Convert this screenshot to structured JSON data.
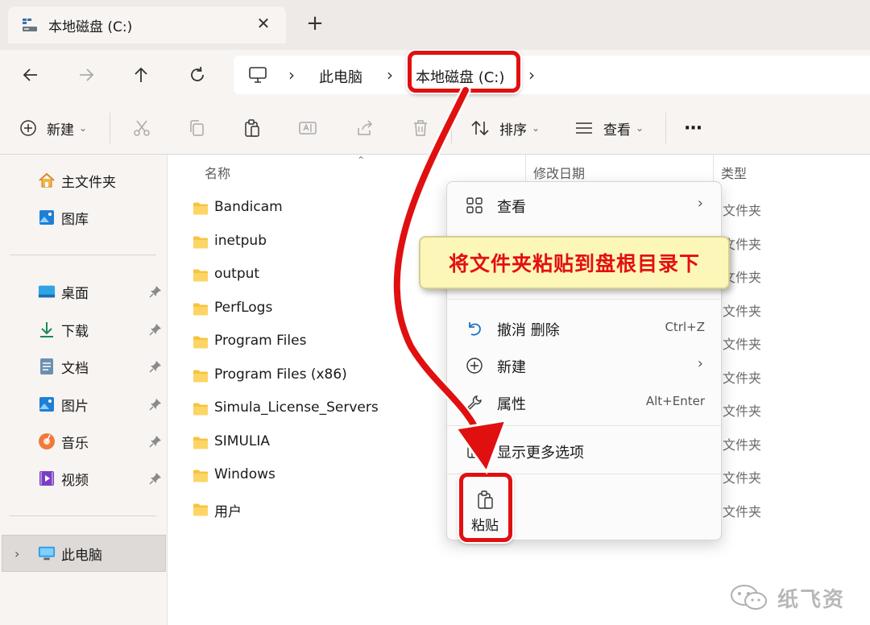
{
  "window": {
    "tab_title": "本地磁盘 (C:)",
    "tab_close": "✕",
    "new_tab": "+"
  },
  "address": {
    "crumbs": [
      "此电脑",
      "本地磁盘 (C:)"
    ],
    "separator": "›"
  },
  "commandbar": {
    "new_label": "新建",
    "sort_label": "排序",
    "view_label": "查看",
    "more_label": "···"
  },
  "sidebar": {
    "items": [
      {
        "label": "主文件夹",
        "icon": "home-icon"
      },
      {
        "label": "图库",
        "icon": "gallery-icon"
      },
      {
        "label": "桌面",
        "icon": "desktop-icon",
        "pinned": true
      },
      {
        "label": "下载",
        "icon": "download-icon",
        "pinned": true
      },
      {
        "label": "文档",
        "icon": "document-icon",
        "pinned": true
      },
      {
        "label": "图片",
        "icon": "pictures-icon",
        "pinned": true
      },
      {
        "label": "音乐",
        "icon": "music-icon",
        "pinned": true
      },
      {
        "label": "视频",
        "icon": "video-icon",
        "pinned": true
      },
      {
        "label": "此电脑",
        "icon": "this-pc-icon",
        "selected": true
      }
    ]
  },
  "list": {
    "columns": {
      "name": "名称",
      "modified": "修改日期",
      "type": "类型"
    },
    "rows": [
      {
        "name": "Bandicam",
        "type": "文件夹"
      },
      {
        "name": "inetpub",
        "type": "文件夹"
      },
      {
        "name": "output",
        "type": "文件夹"
      },
      {
        "name": "PerfLogs",
        "type": "文件夹"
      },
      {
        "name": "Program Files",
        "type": "文件夹"
      },
      {
        "name": "Program Files (x86)",
        "type": "文件夹"
      },
      {
        "name": "Simula_License_Servers",
        "type": "文件夹"
      },
      {
        "name": "SIMULIA",
        "type": "文件夹"
      },
      {
        "name": "Windows",
        "type": "文件夹"
      },
      {
        "name": "用户",
        "type": "文件夹"
      }
    ]
  },
  "context_menu": {
    "view_label": "查看",
    "undo_label": "撤消 删除",
    "undo_shortcut": "Ctrl+Z",
    "new_label": "新建",
    "properties_label": "属性",
    "properties_shortcut": "Alt+Enter",
    "more_options_label": "显示更多选项",
    "paste_label": "粘贴"
  },
  "annotation": {
    "callout_text": "将文件夹粘贴到盘根目录下",
    "color": "#e01010"
  },
  "watermark": {
    "text": "纸飞资"
  }
}
